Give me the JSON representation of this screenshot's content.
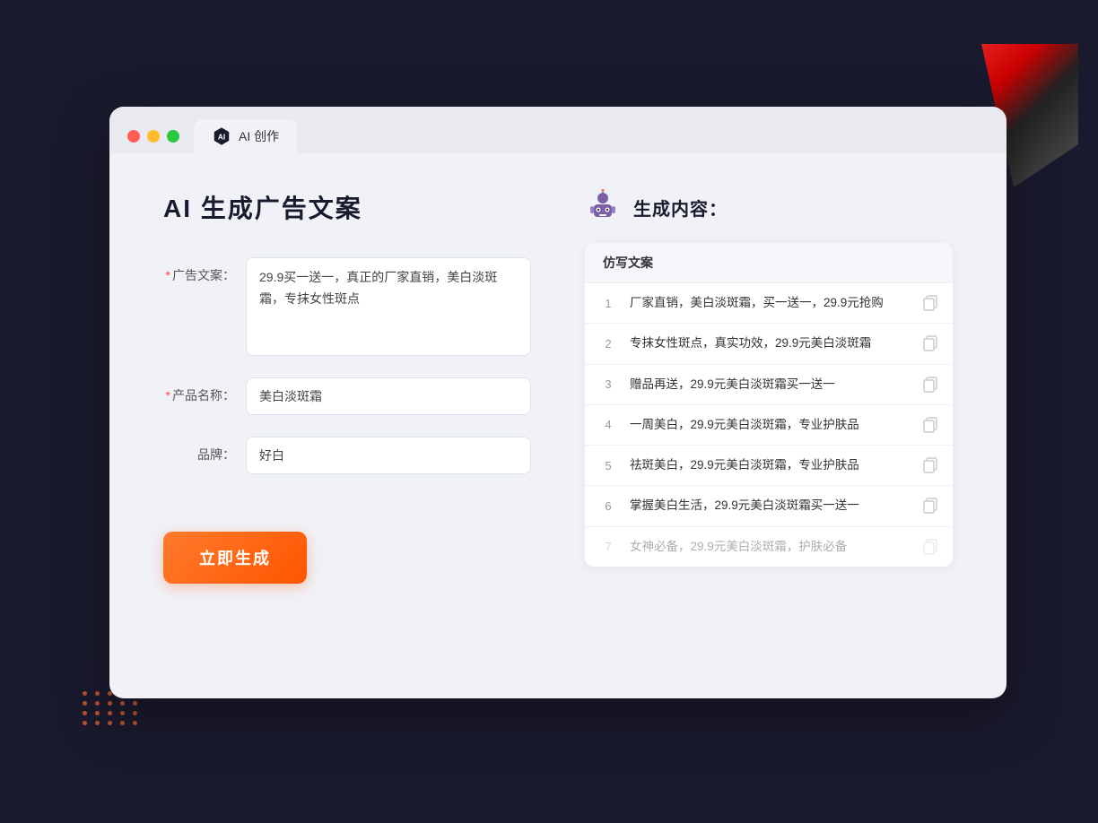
{
  "window": {
    "tab_label": "AI 创作"
  },
  "left_panel": {
    "title": "AI 生成广告文案",
    "fields": [
      {
        "id": "ad_copy",
        "label": "广告文案：",
        "required": true,
        "type": "textarea",
        "value": "29.9买一送一，真正的厂家直销，美白淡斑霜，专抹女性斑点"
      },
      {
        "id": "product_name",
        "label": "产品名称：",
        "required": true,
        "type": "input",
        "value": "美白淡斑霜"
      },
      {
        "id": "brand",
        "label": "品牌：",
        "required": false,
        "type": "input",
        "value": "好白"
      }
    ],
    "generate_btn": "立即生成"
  },
  "right_panel": {
    "title": "生成内容：",
    "table_header": "仿写文案",
    "results": [
      {
        "num": "1",
        "text": "厂家直销，美白淡斑霜，买一送一，29.9元抢购",
        "faded": false
      },
      {
        "num": "2",
        "text": "专抹女性斑点，真实功效，29.9元美白淡斑霜",
        "faded": false
      },
      {
        "num": "3",
        "text": "赠品再送，29.9元美白淡斑霜买一送一",
        "faded": false
      },
      {
        "num": "4",
        "text": "一周美白，29.9元美白淡斑霜，专业护肤品",
        "faded": false
      },
      {
        "num": "5",
        "text": "祛斑美白，29.9元美白淡斑霜，专业护肤品",
        "faded": false
      },
      {
        "num": "6",
        "text": "掌握美白生活，29.9元美白淡斑霜买一送一",
        "faded": false
      },
      {
        "num": "7",
        "text": "女神必备，29.9元美白淡斑霜，护肤必备",
        "faded": true
      }
    ]
  }
}
